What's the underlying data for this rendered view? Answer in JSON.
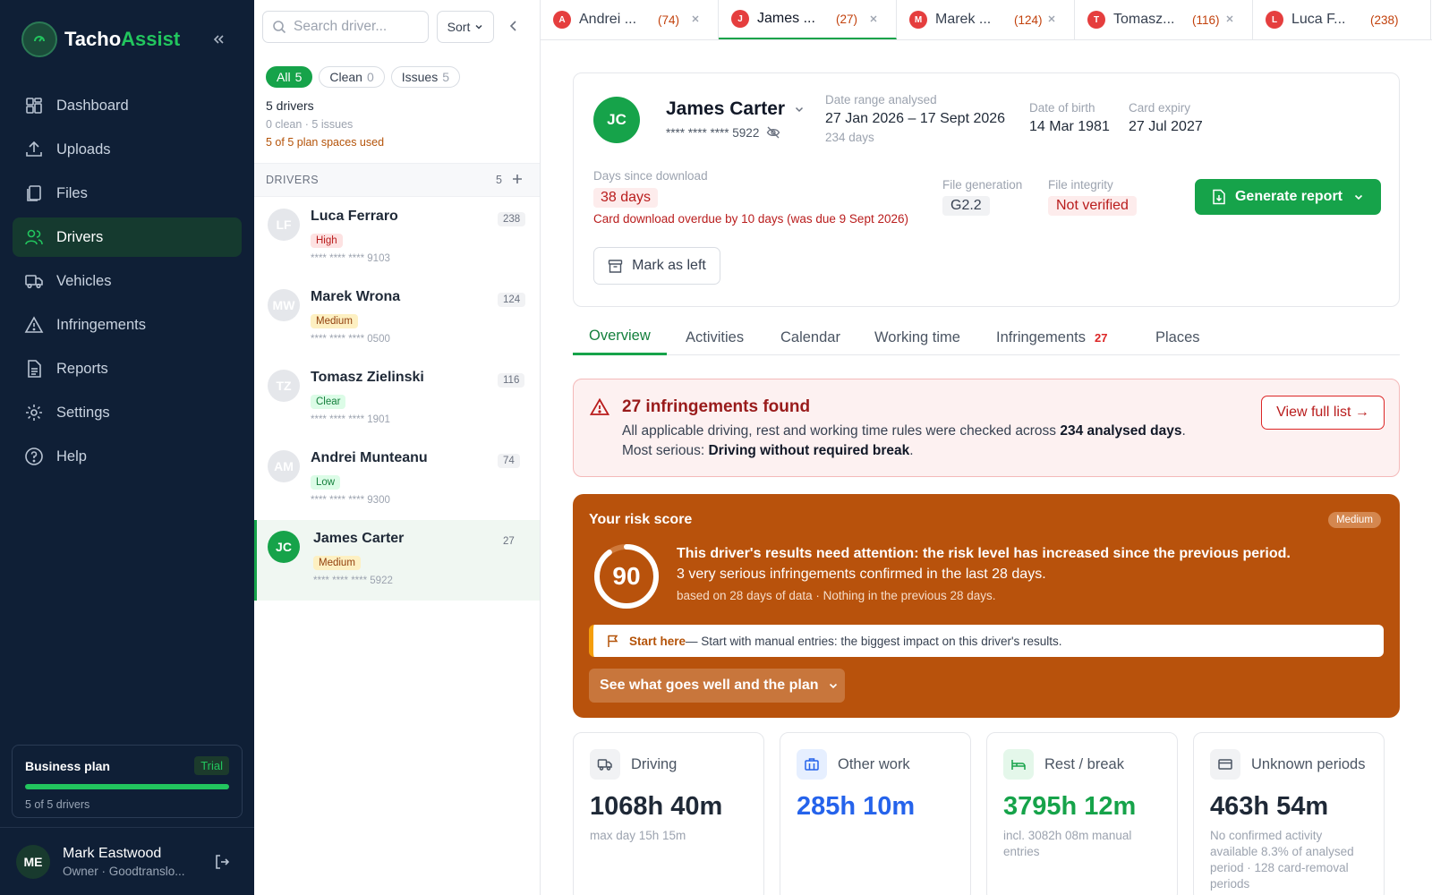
{
  "app": {
    "name_part1": "Tacho",
    "name_part2": "Assist"
  },
  "sidebar": {
    "items": [
      {
        "label": "Dashboard",
        "icon": "dashboard-icon",
        "active": false
      },
      {
        "label": "Uploads",
        "icon": "upload-icon",
        "active": false
      },
      {
        "label": "Files",
        "icon": "files-icon",
        "active": false
      },
      {
        "label": "Drivers",
        "icon": "users-icon",
        "active": true
      },
      {
        "label": "Vehicles",
        "icon": "truck-icon",
        "active": false
      },
      {
        "label": "Infringements",
        "icon": "warning-icon",
        "active": false
      },
      {
        "label": "Reports",
        "icon": "report-icon",
        "active": false
      },
      {
        "label": "Settings",
        "icon": "gear-icon",
        "active": false
      },
      {
        "label": "Help",
        "icon": "help-icon",
        "active": false
      }
    ],
    "plan": {
      "name": "Business plan",
      "badge": "Trial",
      "usage": "5 of 5 drivers",
      "fill_fraction": 1.0
    },
    "user": {
      "initials": "ME",
      "name": "Mark Eastwood",
      "role": "Owner · Goodtranslo..."
    }
  },
  "list_panel": {
    "search_placeholder": "Search driver...",
    "sort_label": "Sort",
    "filters": [
      {
        "label": "All",
        "count": "5",
        "active": true
      },
      {
        "label": "Clean",
        "count": "0",
        "active": false
      },
      {
        "label": "Issues",
        "count": "5",
        "active": false
      }
    ],
    "summary": {
      "drivers": "5 drivers",
      "breakdown": "0 clean · 5 issues",
      "plan_usage": "5 of 5 plan spaces used"
    },
    "header": {
      "title": "DRIVERS",
      "count": "5"
    },
    "drivers": [
      {
        "initials": "LF",
        "name": "Luca Ferraro",
        "badge": "High",
        "badge_class": "b-high",
        "card": "**** **** **** 9103",
        "count": "238",
        "selected": false
      },
      {
        "initials": "MW",
        "name": "Marek Wrona",
        "badge": "Medium",
        "badge_class": "b-medium",
        "card": "**** **** **** 0500",
        "count": "124",
        "selected": false
      },
      {
        "initials": "TZ",
        "name": "Tomasz Zielinski",
        "badge": "Clear",
        "badge_class": "b-clear",
        "card": "**** **** **** 1901",
        "count": "116",
        "selected": false
      },
      {
        "initials": "AM",
        "name": "Andrei Munteanu",
        "badge": "Low",
        "badge_class": "b-low",
        "card": "**** **** **** 9300",
        "count": "74",
        "selected": false
      },
      {
        "initials": "JC",
        "name": "James Carter",
        "badge": "Medium",
        "badge_class": "b-medium",
        "card": "**** **** **** 5922",
        "count": "27",
        "selected": true
      }
    ]
  },
  "tabs": [
    {
      "initial": "A",
      "name": "Andrei ...",
      "count": "(74)",
      "active": false
    },
    {
      "initial": "J",
      "name": "James ...",
      "count": "(27)",
      "active": true
    },
    {
      "initial": "M",
      "name": "Marek ...",
      "count": "(124)",
      "active": false
    },
    {
      "initial": "T",
      "name": "Tomasz...",
      "count": "(116)",
      "active": false
    },
    {
      "initial": "L",
      "name": "Luca F...",
      "count": "(238)",
      "active": false
    }
  ],
  "profile": {
    "initials": "JC",
    "name": "James Carter",
    "card": "**** **** **** 5922",
    "date_range_label": "Date range analysed",
    "date_range": "27 Jan 2026 – 17 Sept 2026",
    "date_range_days": "234 days",
    "dob_label": "Date of birth",
    "dob": "14 Mar 1981",
    "expiry_label": "Card expiry",
    "expiry": "27 Jul 2027",
    "download_label": "Days since download",
    "download_days": "38 days",
    "download_warning": "Card download overdue by 10 days (was due 9 Sept 2026)",
    "generation_label": "File generation",
    "generation": "G2.2",
    "integrity_label": "File integrity",
    "integrity": "Not verified",
    "generate_label": "Generate report",
    "mark_left_label": "Mark as left"
  },
  "subtabs": [
    {
      "label": "Overview",
      "count": "",
      "active": true
    },
    {
      "label": "Activities",
      "count": "",
      "active": false
    },
    {
      "label": "Calendar",
      "count": "",
      "active": false
    },
    {
      "label": "Working time",
      "count": "",
      "active": false
    },
    {
      "label": "Infringements",
      "count": "27",
      "active": false
    },
    {
      "label": "Places",
      "count": "",
      "active": false
    }
  ],
  "alert": {
    "title": "27 infringements found",
    "line1_pre": "All applicable driving, rest and working time rules were checked across ",
    "line1_bold": "234 analysed days",
    "line1_post": ".",
    "line2_pre": "Most serious: ",
    "line2_bold": "Driving without required break",
    "line2_post": ".",
    "button": "View full list →"
  },
  "risk": {
    "title": "Your risk score",
    "badge": "Medium",
    "score": "90",
    "score_fraction": 0.9,
    "headline": "This driver's results need attention: the risk level has increased since the previous period.",
    "line2": "3 very serious infringements confirmed in the last 28 days.",
    "line3": "based on 28 days of data · Nothing in the previous 28 days.",
    "start_label": "Start here",
    "start_text": " — Start with manual entries: the biggest impact on this driver's results.",
    "plan_button": "See what goes well and the plan"
  },
  "stats": [
    {
      "label": "Driving",
      "value": "1068h 40m",
      "note": "max day 15h 15m",
      "icon": "truck-icon",
      "color": "#1f2937",
      "icon_bg": "#f1f2f4",
      "icon_color": "#4b5563"
    },
    {
      "label": "Other work",
      "value": "285h 10m",
      "note": "",
      "icon": "briefcase-icon",
      "color": "#2563eb",
      "icon_bg": "#e6efff",
      "icon_color": "#2563eb"
    },
    {
      "label": "Rest / break",
      "value": "3795h 12m",
      "note": "incl. 3082h 08m manual entries",
      "icon": "bed-icon",
      "color": "#16a34a",
      "icon_bg": "#e4f7ea",
      "icon_color": "#16a34a"
    },
    {
      "label": "Unknown periods",
      "value": "463h 54m",
      "note": "No confirmed activity available 8.3% of analysed period · 128 card-removal periods",
      "icon": "card-icon",
      "color": "#1f2937",
      "icon_bg": "#f1f2f4",
      "icon_color": "#4b5563"
    }
  ]
}
